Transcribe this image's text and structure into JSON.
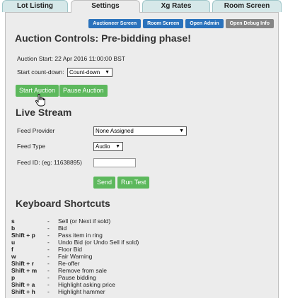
{
  "tabs": [
    {
      "label": "Lot Listing",
      "active": false
    },
    {
      "label": "Settings",
      "active": true
    },
    {
      "label": "Xg Rates",
      "active": false
    },
    {
      "label": "Room Screen",
      "active": false
    }
  ],
  "toolbar": {
    "auctioneer": "Auctioneer Screen",
    "room": "Room Screen",
    "admin": "Open Admin",
    "debug": "Open Debug Info"
  },
  "colors": {
    "primary_button": "#2a72bc",
    "secondary_button": "#858585",
    "green_button": "#5cb85c"
  },
  "auction": {
    "title": "Auction Controls: Pre-bidding phase!",
    "start_label": "Auction Start:",
    "start_value": "22 Apr 2016 11:00:00 BST",
    "countdown_label": "Start count-down:",
    "countdown_value": "Count-down",
    "start_button": "Start Auction",
    "pause_button": "Pause Auction"
  },
  "livestream": {
    "title": "Live Stream",
    "provider_label": "Feed Provider",
    "provider_value": "None Assigned",
    "type_label": "Feed Type",
    "type_value": "Audio",
    "feedid_label": "Feed ID: (eg: 11638895)",
    "feedid_value": "",
    "send_button": "Send",
    "test_button": "Run Test"
  },
  "shortcuts": {
    "title": "Keyboard Shortcuts",
    "items": [
      {
        "key": "s",
        "desc": "Sell (or Next if sold)"
      },
      {
        "key": "b",
        "desc": "Bid"
      },
      {
        "key": "Shift + p",
        "desc": "Pass item in ring"
      },
      {
        "key": "u",
        "desc": "Undo Bid (or Undo Sell if sold)"
      },
      {
        "key": "f",
        "desc": "Floor Bid"
      },
      {
        "key": "w",
        "desc": "Fair Warning"
      },
      {
        "key": "Shift + r",
        "desc": "Re-offer"
      },
      {
        "key": "Shift + m",
        "desc": "Remove from sale"
      },
      {
        "key": "p",
        "desc": "Pause bidding"
      },
      {
        "key": "Shift + a",
        "desc": "Highlight asking price"
      },
      {
        "key": "Shift + h",
        "desc": "Highlight hammer"
      }
    ]
  }
}
